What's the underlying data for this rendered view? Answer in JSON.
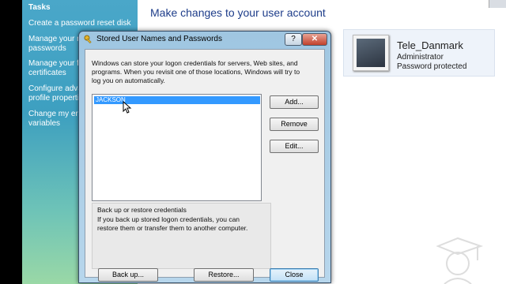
{
  "sidebar": {
    "heading": "Tasks",
    "items": [
      {
        "label": "Create a password reset disk"
      },
      {
        "label": "Manage your network passwords"
      },
      {
        "label": "Manage your file encryption certificates"
      },
      {
        "label": "Configure advanced user profile properties"
      },
      {
        "label": "Change my environment variables"
      }
    ]
  },
  "main": {
    "title": "Make changes to your user account"
  },
  "user": {
    "name": "Tele_Danmark",
    "role": "Administrator",
    "password_status": "Password protected"
  },
  "dialog": {
    "title": "Stored User Names and Passwords",
    "help_label": "?",
    "close_x_label": "✕",
    "description": "Windows can store your logon credentials for servers, Web sites, and programs. When you revisit one of those locations, Windows will try to log you on automatically.",
    "credentials": [
      "JACKSON"
    ],
    "buttons": {
      "add": "Add...",
      "remove": "Remove",
      "edit": "Edit...",
      "backup": "Back up...",
      "restore": "Restore...",
      "close": "Close"
    },
    "backup_group": {
      "title": "Back up or restore credentials",
      "description": "If you back up stored logon credentials, you can restore them or transfer them to another computer."
    }
  },
  "icons": {
    "dialog": "key-icon",
    "cursor": "mouse-pointer-icon",
    "user": "user-avatar",
    "watermark": "graduate-icon"
  }
}
